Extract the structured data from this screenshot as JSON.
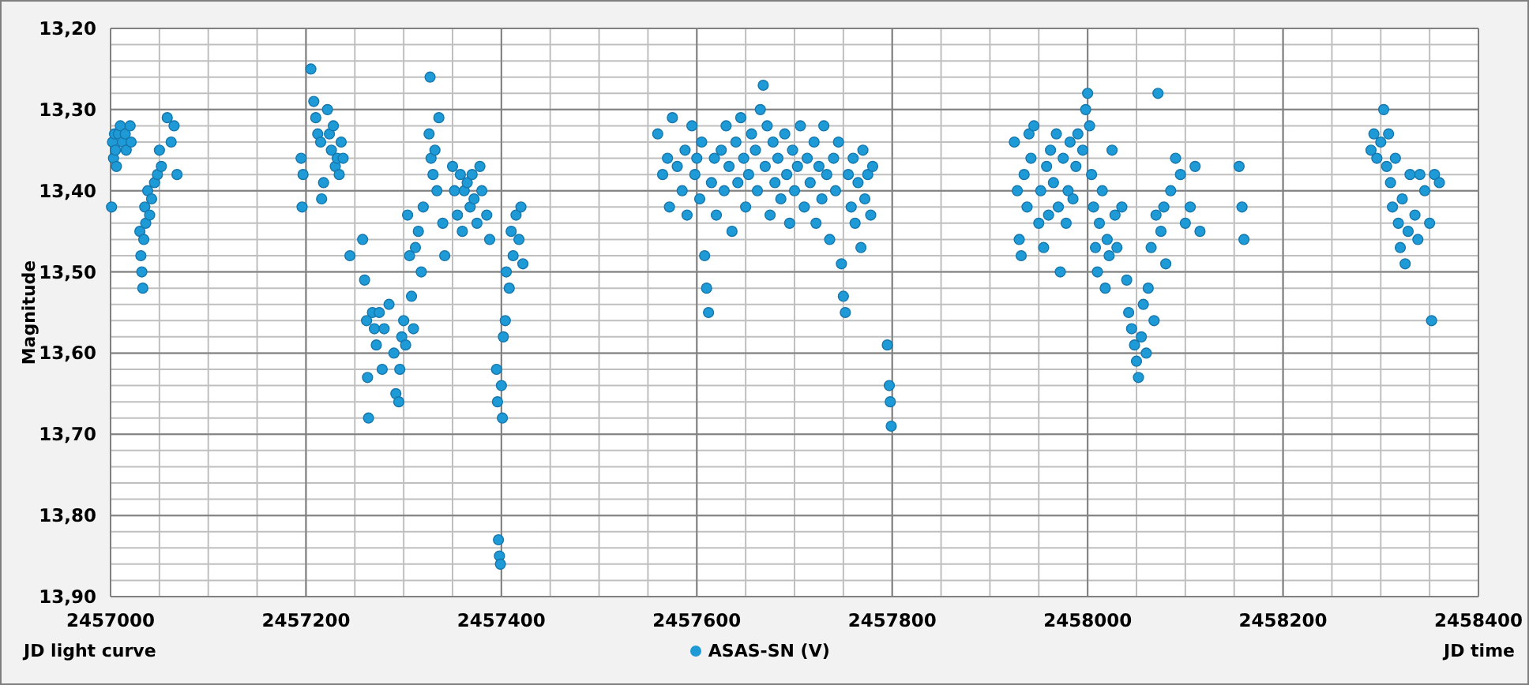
{
  "chart": {
    "chart_data": {
      "type": "scatter",
      "title": "JD light curve",
      "xlabel": "JD time",
      "ylabel": "Magnitude",
      "xlim": [
        2457000,
        2458400
      ],
      "ylim": [
        13.9,
        13.2
      ],
      "grid": true,
      "xticks": [
        2457000,
        2457200,
        2457400,
        2457600,
        2457800,
        2458000,
        2458200,
        2458400
      ],
      "yticks": [
        {
          "value": 13.2,
          "label": "13,20"
        },
        {
          "value": 13.3,
          "label": "13,30"
        },
        {
          "value": 13.4,
          "label": "13,40"
        },
        {
          "value": 13.5,
          "label": "13,50"
        },
        {
          "value": 13.6,
          "label": "13,60"
        },
        {
          "value": 13.7,
          "label": "13,70"
        },
        {
          "value": 13.8,
          "label": "13,80"
        },
        {
          "value": 13.9,
          "label": "13,90"
        }
      ],
      "x": [
        2457002,
        2457003,
        2457004,
        2457005,
        2457006,
        2457008,
        2457010,
        2457012,
        2457015,
        2457016,
        2457001,
        2457020,
        2457021,
        2457030,
        2457031,
        2457032,
        2457033,
        2457034,
        2457035,
        2457036,
        2457038,
        2457040,
        2457042,
        2457045,
        2457048,
        2457050,
        2457052,
        2457058,
        2457062,
        2457065,
        2457068,
        2457195,
        2457196,
        2457197,
        2457205,
        2457208,
        2457210,
        2457212,
        2457215,
        2457216,
        2457218,
        2457222,
        2457224,
        2457226,
        2457228,
        2457230,
        2457232,
        2457234,
        2457236,
        2457238,
        2457245,
        2457258,
        2457260,
        2457262,
        2457263,
        2457264,
        2457268,
        2457270,
        2457272,
        2457275,
        2457278,
        2457280,
        2457285,
        2457290,
        2457292,
        2457295,
        2457296,
        2457298,
        2457300,
        2457302,
        2457304,
        2457306,
        2457308,
        2457310,
        2457312,
        2457315,
        2457318,
        2457320,
        2457326,
        2457327,
        2457328,
        2457330,
        2457332,
        2457334,
        2457336,
        2457340,
        2457342,
        2457350,
        2457352,
        2457355,
        2457358,
        2457360,
        2457362,
        2457365,
        2457368,
        2457370,
        2457372,
        2457375,
        2457378,
        2457380,
        2457385,
        2457388,
        2457395,
        2457396,
        2457397,
        2457398,
        2457399,
        2457400,
        2457401,
        2457402,
        2457404,
        2457405,
        2457408,
        2457410,
        2457412,
        2457415,
        2457418,
        2457420,
        2457422,
        2457560,
        2457565,
        2457570,
        2457572,
        2457575,
        2457580,
        2457585,
        2457588,
        2457590,
        2457595,
        2457598,
        2457600,
        2457603,
        2457605,
        2457608,
        2457610,
        2457612,
        2457615,
        2457618,
        2457620,
        2457625,
        2457628,
        2457630,
        2457633,
        2457636,
        2457640,
        2457642,
        2457645,
        2457648,
        2457650,
        2457653,
        2457656,
        2457660,
        2457662,
        2457665,
        2457668,
        2457670,
        2457672,
        2457675,
        2457678,
        2457680,
        2457683,
        2457686,
        2457690,
        2457692,
        2457695,
        2457698,
        2457700,
        2457703,
        2457706,
        2457710,
        2457713,
        2457716,
        2457720,
        2457722,
        2457725,
        2457728,
        2457730,
        2457733,
        2457736,
        2457740,
        2457742,
        2457745,
        2457748,
        2457750,
        2457752,
        2457755,
        2457758,
        2457760,
        2457762,
        2457765,
        2457768,
        2457770,
        2457772,
        2457775,
        2457778,
        2457780,
        2457795,
        2457797,
        2457798,
        2457799,
        2457925,
        2457928,
        2457930,
        2457932,
        2457935,
        2457938,
        2457940,
        2457942,
        2457945,
        2457950,
        2457952,
        2457955,
        2457958,
        2457960,
        2457962,
        2457965,
        2457968,
        2457970,
        2457972,
        2457975,
        2457978,
        2457980,
        2457982,
        2457985,
        2457988,
        2457990,
        2457995,
        2457998,
        2458000,
        2458002,
        2458004,
        2458006,
        2458008,
        2458010,
        2458012,
        2458015,
        2458018,
        2458020,
        2458022,
        2458025,
        2458028,
        2458030,
        2458035,
        2458040,
        2458042,
        2458045,
        2458048,
        2458050,
        2458052,
        2458055,
        2458057,
        2458060,
        2458062,
        2458065,
        2458068,
        2458070,
        2458072,
        2458075,
        2458078,
        2458080,
        2458085,
        2458090,
        2458095,
        2458100,
        2458105,
        2458110,
        2458115,
        2458155,
        2458158,
        2458160,
        2458290,
        2458293,
        2458296,
        2458300,
        2458303,
        2458306,
        2458308,
        2458310,
        2458312,
        2458315,
        2458318,
        2458320,
        2458322,
        2458325,
        2458328,
        2458330,
        2458335,
        2458338,
        2458340,
        2458345,
        2458350,
        2458352,
        2458355,
        2458360
      ],
      "series": [
        {
          "name": "ASAS-SN (V)",
          "color": "#1e9ad6",
          "values": [
            13.34,
            13.36,
            13.33,
            13.35,
            13.37,
            13.33,
            13.32,
            13.34,
            13.33,
            13.35,
            13.42,
            13.32,
            13.34,
            13.45,
            13.48,
            13.5,
            13.52,
            13.46,
            13.42,
            13.44,
            13.4,
            13.43,
            13.41,
            13.39,
            13.38,
            13.35,
            13.37,
            13.31,
            13.34,
            13.32,
            13.38,
            13.36,
            13.42,
            13.38,
            13.25,
            13.29,
            13.31,
            13.33,
            13.34,
            13.41,
            13.39,
            13.3,
            13.33,
            13.35,
            13.32,
            13.37,
            13.36,
            13.38,
            13.34,
            13.36,
            13.48,
            13.46,
            13.51,
            13.56,
            13.63,
            13.68,
            13.55,
            13.57,
            13.59,
            13.55,
            13.62,
            13.57,
            13.54,
            13.6,
            13.65,
            13.66,
            13.62,
            13.58,
            13.56,
            13.59,
            13.43,
            13.48,
            13.53,
            13.57,
            13.47,
            13.45,
            13.5,
            13.42,
            13.33,
            13.26,
            13.36,
            13.38,
            13.35,
            13.4,
            13.31,
            13.44,
            13.48,
            13.37,
            13.4,
            13.43,
            13.38,
            13.45,
            13.4,
            13.39,
            13.42,
            13.38,
            13.41,
            13.44,
            13.37,
            13.4,
            13.43,
            13.46,
            13.62,
            13.66,
            13.83,
            13.85,
            13.86,
            13.64,
            13.68,
            13.58,
            13.56,
            13.5,
            13.52,
            13.45,
            13.48,
            13.43,
            13.46,
            13.42,
            13.49,
            13.33,
            13.38,
            13.36,
            13.42,
            13.31,
            13.37,
            13.4,
            13.35,
            13.43,
            13.32,
            13.38,
            13.36,
            13.41,
            13.34,
            13.48,
            13.52,
            13.55,
            13.39,
            13.36,
            13.43,
            13.35,
            13.4,
            13.32,
            13.37,
            13.45,
            13.34,
            13.39,
            13.31,
            13.36,
            13.42,
            13.38,
            13.33,
            13.35,
            13.4,
            13.3,
            13.27,
            13.37,
            13.32,
            13.43,
            13.34,
            13.39,
            13.36,
            13.41,
            13.33,
            13.38,
            13.44,
            13.35,
            13.4,
            13.37,
            13.32,
            13.42,
            13.36,
            13.39,
            13.34,
            13.44,
            13.37,
            13.41,
            13.32,
            13.38,
            13.46,
            13.36,
            13.4,
            13.34,
            13.49,
            13.53,
            13.55,
            13.38,
            13.42,
            13.36,
            13.44,
            13.39,
            13.47,
            13.35,
            13.41,
            13.38,
            13.43,
            13.37,
            13.59,
            13.64,
            13.66,
            13.69,
            13.34,
            13.4,
            13.46,
            13.48,
            13.38,
            13.42,
            13.33,
            13.36,
            13.32,
            13.44,
            13.4,
            13.47,
            13.37,
            13.43,
            13.35,
            13.39,
            13.33,
            13.42,
            13.5,
            13.36,
            13.44,
            13.4,
            13.34,
            13.41,
            13.37,
            13.33,
            13.35,
            13.3,
            13.28,
            13.32,
            13.38,
            13.42,
            13.47,
            13.5,
            13.44,
            13.4,
            13.52,
            13.46,
            13.48,
            13.35,
            13.43,
            13.47,
            13.42,
            13.51,
            13.55,
            13.57,
            13.59,
            13.61,
            13.63,
            13.58,
            13.54,
            13.6,
            13.52,
            13.47,
            13.56,
            13.43,
            13.28,
            13.45,
            13.42,
            13.49,
            13.4,
            13.36,
            13.38,
            13.44,
            13.42,
            13.37,
            13.45,
            13.37,
            13.42,
            13.46,
            13.35,
            13.33,
            13.36,
            13.34,
            13.3,
            13.37,
            13.33,
            13.39,
            13.42,
            13.36,
            13.44,
            13.47,
            13.41,
            13.49,
            13.45,
            13.38,
            13.43,
            13.46,
            13.38,
            13.4,
            13.44,
            13.56,
            13.38,
            13.39
          ]
        }
      ]
    }
  }
}
